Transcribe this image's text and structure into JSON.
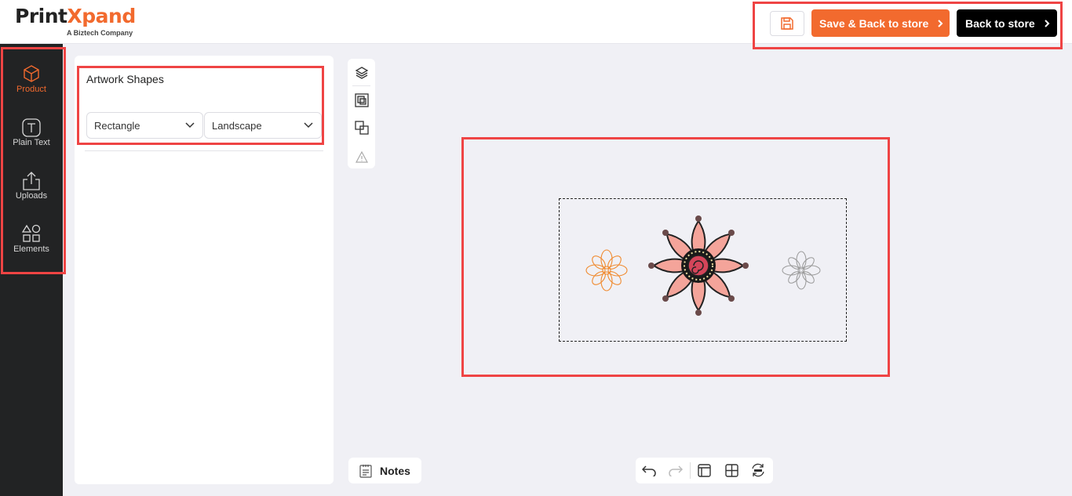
{
  "header": {
    "logo_part1": "Print",
    "logo_part2": "X",
    "logo_part3": "pand",
    "logo_tagline": "A Biztech Company",
    "save_back_label": "Save & Back to store",
    "back_label": "Back to store"
  },
  "sidebar": {
    "items": [
      {
        "label": "Product",
        "icon": "cube-icon"
      },
      {
        "label": "Plain Text",
        "icon": "text-icon"
      },
      {
        "label": "Uploads",
        "icon": "upload-icon"
      },
      {
        "label": "Elements",
        "icon": "shapes-icon"
      }
    ],
    "active": "Product"
  },
  "panel": {
    "title": "Artwork Shapes",
    "shape_select": {
      "value": "Rectangle"
    },
    "orientation_select": {
      "value": "Landscape"
    }
  },
  "toolbar": {
    "notes_label": "Notes"
  },
  "colors": {
    "accent": "#f26a2e",
    "highlight": "#ef4444",
    "sidebar_bg": "#222324"
  }
}
